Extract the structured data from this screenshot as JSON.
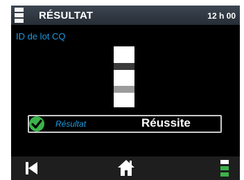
{
  "header": {
    "title": "RÉSULTAT",
    "time": "12 h 00"
  },
  "main": {
    "subtitle": "ID de lot CQ",
    "result_label": "Résultat",
    "result_value": "Réussite"
  },
  "icons": {
    "menu": "menu-icon",
    "strip": "test-strip-icon",
    "check": "check-icon",
    "back": "back-icon",
    "home": "home-icon",
    "options": "options-menu-icon"
  },
  "colors": {
    "accent": "#1e9be0",
    "success": "#3bb34a",
    "background": "#000000",
    "header": "#2f3742"
  }
}
